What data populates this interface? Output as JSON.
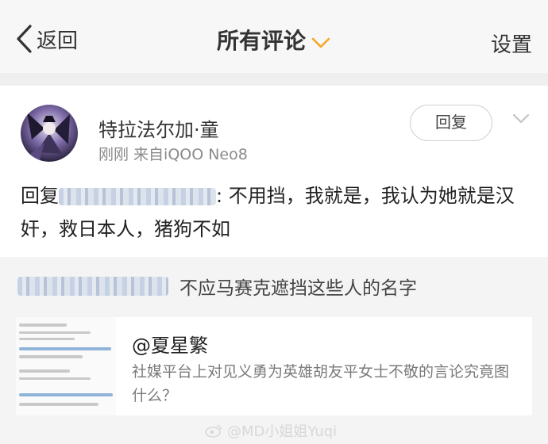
{
  "nav": {
    "back_label": "返回",
    "title": "所有评论",
    "settings_label": "设置"
  },
  "comment": {
    "username": "特拉法尔加·童",
    "meta": "刚刚 来自iQOO Neo8",
    "reply_button": "回复",
    "reply_prefix": "回复",
    "text": ": 不用挡，我就是，我认为她就是汉奸，救日本人，猪狗不如"
  },
  "quoted": {
    "text": "不应马赛克遮挡这些人的名字"
  },
  "link_card": {
    "title": "@夏星繁",
    "description": "社媒平台上对见义勇为英雄胡友平女士不敬的言论究竟图什么？"
  },
  "watermark": "@MD小姐姐Yuqi",
  "colors": {
    "accent_chevron": "#f5a623",
    "link_blue": "#8fb3d9"
  }
}
